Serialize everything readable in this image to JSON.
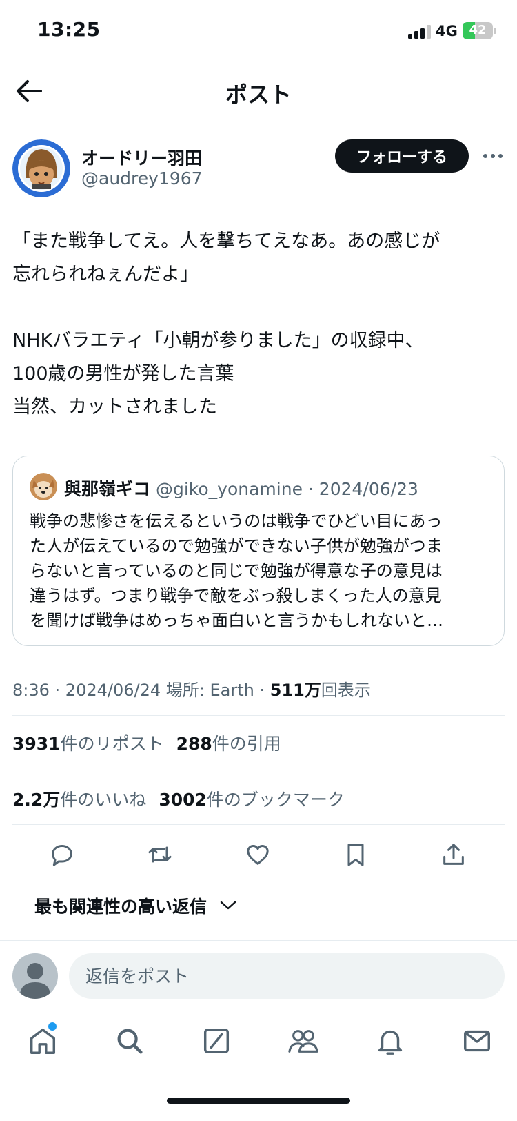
{
  "status_bar": {
    "time": "13:25",
    "network": "4G",
    "battery_level": "42",
    "battery_fraction": 0.42
  },
  "header": {
    "title": "ポスト",
    "back_icon": "arrow-left-icon"
  },
  "author": {
    "name": "オードリー羽田",
    "handle": "@audrey1967",
    "follow_label": "フォローする",
    "more_icon": "more-horizontal-icon"
  },
  "post": {
    "lines": [
      "「また戦争してえ。人を撃ちてえなあ。あの感じが",
      "忘れられねぇんだよ」",
      "NHKバラエティ「小朝が参りました」の収録中、",
      "100歳の男性が発した言葉",
      "当然、カットされました"
    ]
  },
  "quote": {
    "name": "與那嶺ギコ",
    "handle": "@giko_yonamine",
    "date": "2024/06/23",
    "lines": [
      "戦争の悲惨さを伝えるというのは戦争でひどい目にあっ",
      "た人が伝えているので勉強ができない子供が勉強がつま",
      "らないと言っているのと同じで勉強が得意な子の意見は",
      "違うはず。つまり戦争で敵をぶっ殺しまくった人の意見",
      "を聞けば戦争はめっちゃ面白いと言うかもしれないと…"
    ]
  },
  "meta": {
    "time": "8:36",
    "date": "2024/06/24",
    "location": "場所: Earth",
    "views_count": "511万",
    "views_label": "回表示"
  },
  "stats": {
    "reposts_count": "3931",
    "reposts_label": "件のリポスト",
    "quotes_count": "288",
    "quotes_label": "件の引用",
    "likes_count": "2.2万",
    "likes_label": "件のいいね",
    "bookmarks_count": "3002",
    "bookmarks_label": "件のブックマーク"
  },
  "actions": [
    "reply-icon",
    "repost-icon",
    "like-icon",
    "bookmark-icon",
    "share-icon"
  ],
  "replies": {
    "sort_label": "最も関連性の高い返信",
    "placeholder": "返信をポスト"
  },
  "tabbar": [
    "home-icon",
    "search-icon",
    "grok-icon",
    "communities-icon",
    "notifications-icon",
    "messages-icon"
  ],
  "colors": {
    "text": "#0f1419",
    "secondary": "#536471",
    "accent": "#1d9bf0",
    "border": "#cfd9de",
    "battery": "#34c759"
  }
}
